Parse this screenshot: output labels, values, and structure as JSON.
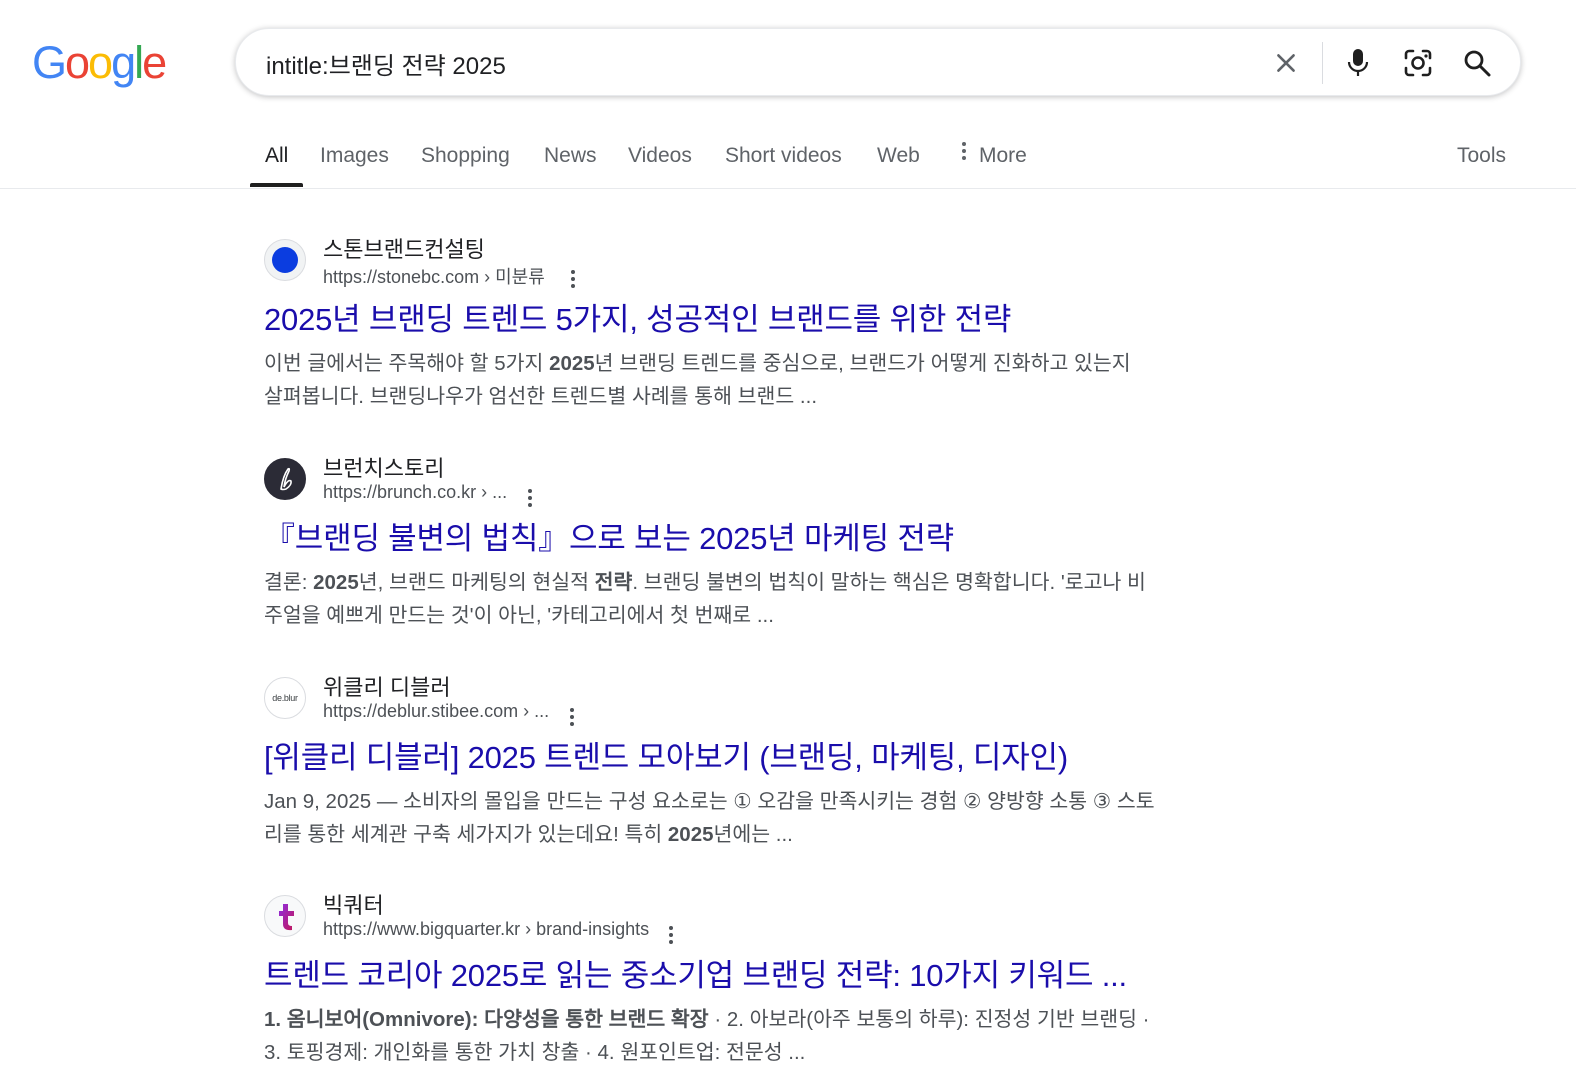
{
  "brand": {
    "letters": [
      "G",
      "o",
      "o",
      "g",
      "l",
      "e"
    ],
    "colors": [
      "#4285F4",
      "#EA4335",
      "#FBBC05",
      "#4285F4",
      "#34A853",
      "#EA4335"
    ]
  },
  "search": {
    "query": "intitle:브랜딩 전략 2025",
    "icons": [
      "close-icon",
      "microphone-icon",
      "camera-lens-icon",
      "search-icon"
    ]
  },
  "tabs": {
    "items": [
      {
        "label": "All",
        "active": true
      },
      {
        "label": "Images"
      },
      {
        "label": "Shopping"
      },
      {
        "label": "News"
      },
      {
        "label": "Videos"
      },
      {
        "label": "Short videos"
      },
      {
        "label": "Web"
      },
      {
        "label": "More",
        "icon": "vertical-dots-icon"
      }
    ],
    "tools_label": "Tools"
  },
  "results": [
    {
      "site_name": "스톤브랜드컨설팅",
      "url": "https://stonebc.com › 미분류",
      "favicon": {
        "name": "blue-dot-favicon",
        "color": "#0B3DE0"
      },
      "title": "2025년 브랜딩 트렌드 5가지, 성공적인 브랜드를 위한 전략",
      "snippet_line1": [
        {
          "text": "이번 글에서는 주목해야 할 5가지 "
        },
        {
          "text": "2025",
          "bold": true
        },
        {
          "text": "년 브랜딩 트렌드를 중심으로, 브랜드가 어떻게 진화하고 있는지"
        }
      ],
      "snippet_line2": [
        {
          "text": "살펴봅니다. 브랜딩나우가 엄선한 트렌드별 사례를 통해 브랜드 ..."
        }
      ]
    },
    {
      "site_name": "브런치스토리",
      "url": "https://brunch.co.kr › ...",
      "favicon": {
        "name": "brunch-favicon",
        "color": "#2B2B36",
        "glyph": "b"
      },
      "title": "『브랜딩 불변의 법칙』으로 보는 2025년 마케팅 전략",
      "snippet_line1": [
        {
          "text": "결론: "
        },
        {
          "text": "2025",
          "bold": true
        },
        {
          "text": "년, 브랜드 마케팅의 현실적 "
        },
        {
          "text": "전략",
          "bold": true
        },
        {
          "text": ". 브랜딩 불변의 법칙이 말하는 핵심은 명확합니다. '로고나 비"
        }
      ],
      "snippet_line2": [
        {
          "text": "주얼을 예쁘게 만드는 것'이 아닌, '카테고리에서 첫 번째로 ..."
        }
      ]
    },
    {
      "site_name": "위클리 디블러",
      "url": "https://deblur.stibee.com › ...",
      "favicon": {
        "name": "deblur-favicon",
        "color": "#ffffff",
        "glyph": "de.blur"
      },
      "title": "[위클리 디블러] 2025 트렌드 모아보기 (브랜딩, 마케팅, 디자인)",
      "snippet_line1": [
        {
          "text": "Jan 9, 2025 — 소비자의 몰입을 만드는 구성 요소로는 ① 오감을 만족시키는 경험 ② 양방향 소통 ③ 스토"
        }
      ],
      "snippet_line2": [
        {
          "text": "리를 통한 세계관 구축 세가지가 있는데요! 특히 "
        },
        {
          "text": "2025",
          "bold": true
        },
        {
          "text": "년에는 ..."
        }
      ]
    },
    {
      "site_name": "빅쿼터",
      "url": "https://www.bigquarter.kr › brand-insights",
      "favicon": {
        "name": "bigquarter-favicon",
        "color": "#7B2FF7",
        "glyph": "t"
      },
      "title": "트렌드 코리아 2025로 읽는 중소기업 브랜딩 전략: 10가지 키워드 ...",
      "snippet_line1": [
        {
          "text": "1. 옴니보어(Omnivore): 다양성을 통한 브랜드 확장",
          "bold": true
        },
        {
          "text": " · 2. 아보라(아주 보통의 하루): 진정성 기반 브랜딩 ·"
        }
      ],
      "snippet_line2": [
        {
          "text": "3. 토핑경제: 개인화를 통한 가치 창출 · 4. 원포인트업: 전문성 ..."
        }
      ]
    }
  ]
}
